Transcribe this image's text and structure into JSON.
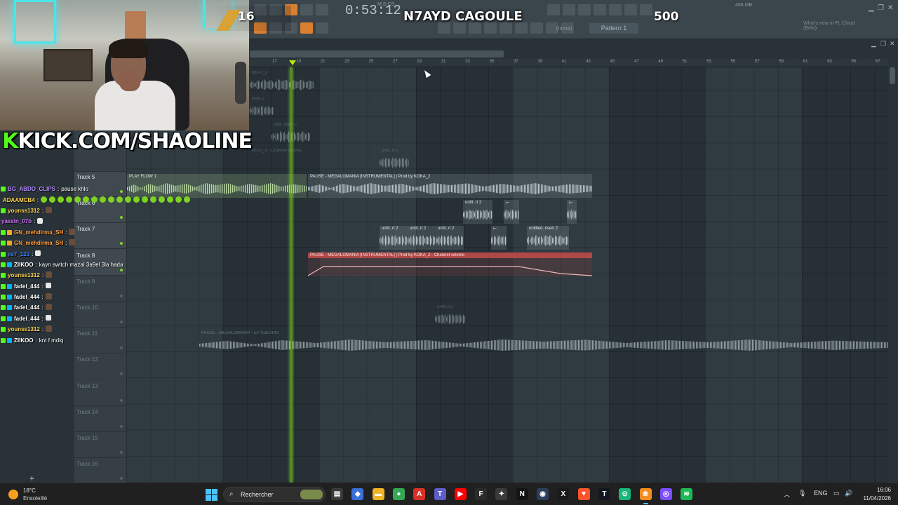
{
  "banner": {
    "left_number": "16",
    "title": "N7AYD CAGOULE",
    "right_number": "500"
  },
  "webcam": {
    "channel_url_k": "K",
    "channel_url_rest": "KICK.COM/SHAOLINE"
  },
  "fl_toolbar": {
    "time": "0:53:12",
    "time_label": "M:S:CS",
    "pattern": "Pattern 1",
    "none_selector": "(none)",
    "hint": "What's new in FL Cloud (Beta)",
    "memory": "466 MB",
    "close_label": "✕"
  },
  "ruler": {
    "ticks": [
      "17",
      "19",
      "21",
      "23",
      "25",
      "27",
      "29",
      "31",
      "33",
      "35",
      "37",
      "39",
      "41",
      "43",
      "45",
      "47",
      "49",
      "51",
      "53",
      "55",
      "57",
      "58",
      "61",
      "63",
      "65",
      "67"
    ]
  },
  "tracks": [
    {
      "name": "Track 5",
      "dim": false
    },
    {
      "name": "Track 6",
      "dim": false
    },
    {
      "name": "Track 7",
      "dim": false
    },
    {
      "name": "Track 8",
      "dim": false
    },
    {
      "name": "Track 9",
      "dim": true
    },
    {
      "name": "Track 10",
      "dim": true
    },
    {
      "name": "Track 11",
      "dim": true
    },
    {
      "name": "Track 12",
      "dim": true
    },
    {
      "name": "Track 13",
      "dim": true
    },
    {
      "name": "Track 14",
      "dim": true
    },
    {
      "name": "Track 15",
      "dim": true
    },
    {
      "name": "Track 16",
      "dim": true
    }
  ],
  "clips": {
    "beat": "BEAT_2",
    "untit_top": "untit..2",
    "untit_insert": "untit..nsert 2",
    "beat_volume": "BEAT_2 - Channel volume",
    "untit_t4": "untit..rt 2",
    "play_flow": "PLAY FLOW 1",
    "pause_main": "PAUSE - MEGALOMANIA [INSTRUMENTAL] | Prod by KOKA_2",
    "untit_a": "untit..rt 2",
    "untit_b": "untit..rt 2",
    "untit_c": "untit..rt 2",
    "untit_d": "untit..rt 2",
    "untitled_insert": "untitled..nsert 2",
    "pause_volume": "PAUSE - MEGALOMANIA [INSTRUMENTAL] | Prod by KOKA_2 - Channel volume",
    "untit_ghost": "untit..rt 2",
    "pause_solaris": "PAUSE - MEGALOMANIA - EP SOLARIS"
  },
  "chat": [
    {
      "user": "BG_ABDO_CLIPS",
      "color": "#b68cff",
      "badges": [
        "green"
      ],
      "msg": "pause khlo",
      "emotes": 0
    },
    {
      "user": "ADAAMCB4",
      "color": "#ffd54f",
      "badges": [
        "green"
      ],
      "msg": "",
      "emotes": 18
    },
    {
      "user": "younss1312",
      "color": "#ffd54f",
      "badges": [
        "green"
      ],
      "msg": "",
      "emotes": 1
    },
    {
      "user": "yassin_07b",
      "color": "#d36bff",
      "badges": [],
      "msg": "",
      "emotes": 1
    },
    {
      "user": "GN_mehdirma_SH",
      "color": "#ff9c3b",
      "badges": [
        "green",
        "gold"
      ],
      "msg": "",
      "emotes": 1
    },
    {
      "user": "GN_mehdirma_SH",
      "color": "#ff9c3b",
      "badges": [
        "green",
        "gold"
      ],
      "msg": "",
      "emotes": 1
    },
    {
      "user": "es7_123",
      "color": "#3b7cff",
      "badges": [
        "green"
      ],
      "msg": "",
      "emotes": 1
    },
    {
      "user": "ZIIKOO",
      "color": "#ffffff",
      "badges": [
        "green",
        "blue"
      ],
      "msg": "kayn switch mazal 3a9el 3la hada",
      "emotes": 0
    },
    {
      "user": "younss1312",
      "color": "#ffd54f",
      "badges": [
        "green"
      ],
      "msg": "",
      "emotes": 1
    },
    {
      "user": "fadel_444",
      "color": "#ffffff",
      "badges": [
        "green",
        "blue"
      ],
      "msg": "",
      "emotes": 1
    },
    {
      "user": "fadel_444",
      "color": "#ffffff",
      "badges": [
        "green",
        "blue"
      ],
      "msg": "",
      "emotes": 1
    },
    {
      "user": "fadel_444",
      "color": "#ffffff",
      "badges": [
        "green",
        "blue"
      ],
      "msg": "",
      "emotes": 1
    },
    {
      "user": "fadel_444",
      "color": "#ffffff",
      "badges": [
        "green",
        "blue"
      ],
      "msg": "",
      "emotes": 1
    },
    {
      "user": "younss1312",
      "color": "#ffd54f",
      "badges": [
        "green"
      ],
      "msg": "",
      "emotes": 1
    },
    {
      "user": "ZIIKOO",
      "color": "#ffffff",
      "badges": [
        "green",
        "blue"
      ],
      "msg": "knt f mdiq",
      "emotes": 0
    }
  ],
  "taskbar": {
    "weather_temp": "18°C",
    "weather_desc": "Ensoleillé",
    "search_label": "Rechercher",
    "lang": "ENG",
    "time": "16:06",
    "date": "11/04/2026",
    "apps": [
      {
        "name": "file-explorer-icon",
        "glyph": "▤",
        "bg": "#3a3a3a"
      },
      {
        "name": "copilot-icon",
        "glyph": "◆",
        "bg": "#3a6fd8"
      },
      {
        "name": "folder-icon",
        "glyph": "▬",
        "bg": "#f0b429"
      },
      {
        "name": "chrome-icon",
        "glyph": "●",
        "bg": "#34a853"
      },
      {
        "name": "acrobat-icon",
        "glyph": "A",
        "bg": "#d93025"
      },
      {
        "name": "teams-icon",
        "glyph": "T",
        "bg": "#5b5fc7"
      },
      {
        "name": "youtube-icon",
        "glyph": "▶",
        "bg": "#ff0000"
      },
      {
        "name": "fn-app-icon",
        "glyph": "F",
        "bg": "#2b2b2b"
      },
      {
        "name": "gamepad-icon",
        "glyph": "✦",
        "bg": "#3a3a3a"
      },
      {
        "name": "netflix-icon",
        "glyph": "N",
        "bg": "#141414"
      },
      {
        "name": "steam-icon",
        "glyph": "◉",
        "bg": "#2a3f5a"
      },
      {
        "name": "xm-app-icon",
        "glyph": "X",
        "bg": "#1a1a1a"
      },
      {
        "name": "brave-icon",
        "glyph": "▼",
        "bg": "#fb542b"
      },
      {
        "name": "tradingview-icon",
        "glyph": "T",
        "bg": "#131722"
      },
      {
        "name": "obs-icon",
        "glyph": "⊙",
        "bg": "#19b67a"
      },
      {
        "name": "fl-studio-icon",
        "glyph": "❀",
        "bg": "#f68b1f"
      },
      {
        "name": "obs-studio-icon",
        "glyph": "◎",
        "bg": "#7b4dff"
      },
      {
        "name": "spotify-icon",
        "glyph": "≋",
        "bg": "#1db954"
      }
    ]
  },
  "colors": {
    "accent_green": "#7ed321",
    "kick_green": "#53fc18",
    "automation_red": "#b04848"
  }
}
